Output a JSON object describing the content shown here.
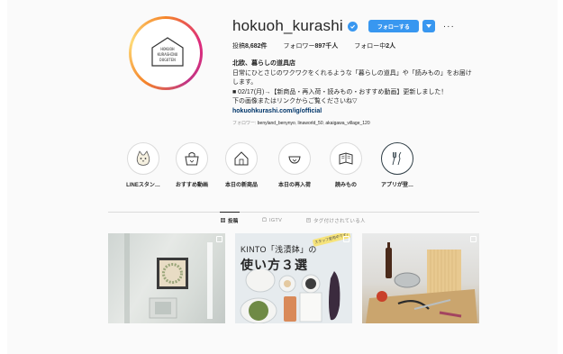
{
  "profile": {
    "username": "hokuoh_kurashi",
    "follow_label": "フォローする",
    "more_label": "···",
    "logo_lines": [
      "HOKUOH",
      "KURASHINO",
      "DOGUTEN"
    ],
    "stats": {
      "posts_label": "投稿",
      "posts_value": "8,682件",
      "followers_label": "フォロワー",
      "followers_value": "897千人",
      "following_label": "フォロー中",
      "following_value": "2人"
    },
    "bio": {
      "name": "北欧、暮らしの道具店",
      "line1": "日常にひとさじのワクワクをくれるような「暮らしの道具」や「読みもの」をお届け",
      "line2": "します。",
      "line3": "■ 02/17(月)→【新商品・再入荷・読みもの・おすすめ動画】更新しました！",
      "line4": "下の画像またはリンクからご覧くださいね▽",
      "link": "hokuohkurashi.com/ig/official"
    },
    "followed_by_label": "フォロワー:",
    "followed_by": [
      "benyland_benynyo",
      "linaworld_50",
      "akaigawa_village_120"
    ]
  },
  "highlights": [
    {
      "label": "LINEスタン…",
      "icon": "cat-icon"
    },
    {
      "label": "おすすめ動画",
      "icon": "shopping-bag-icon"
    },
    {
      "label": "本日の新商品",
      "icon": "house-icon"
    },
    {
      "label": "本日の再入荷",
      "icon": "bowl-icon"
    },
    {
      "label": "読みもの",
      "icon": "book-icon"
    },
    {
      "label": "アプリが登…",
      "icon": "utensils-icon"
    }
  ],
  "tabs": [
    {
      "label": "投稿",
      "icon": "grid-icon",
      "active": true
    },
    {
      "label": "IGTV",
      "icon": "igtv-icon",
      "active": false
    },
    {
      "label": "タグ付けされている人",
      "icon": "tag-user-icon",
      "active": false
    }
  ],
  "posts": [
    {
      "kind": "photo",
      "icon": "carousel-icon"
    },
    {
      "kind": "graphic",
      "icon": "carousel-icon",
      "title1": "KINTO「浅漬鉢」の",
      "title2": "使い方３選",
      "tag": "スタッフ愛用中です♪"
    },
    {
      "kind": "photo",
      "icon": "carousel-icon"
    }
  ],
  "colors": {
    "accent": "#3897f0",
    "text": "#262626",
    "muted": "#8e8e8e",
    "link": "#003569",
    "background": "#fafafa"
  }
}
